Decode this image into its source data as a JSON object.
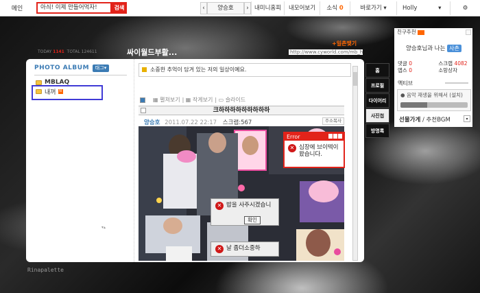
{
  "topbar": {
    "home": "메인",
    "search_value": "아싀! 이제 만들어먹자!",
    "search_button": "검색",
    "user_name": "양승호",
    "nav": [
      "내미니홈피",
      "내모어보기",
      "소식",
      "바로가기"
    ],
    "news_count": "0",
    "account": "Holly"
  },
  "header": {
    "today_label": "TODAY",
    "today_value": "1141",
    "total_label": "TOTAL",
    "total_value": "124611",
    "title": "싸이월드부활...",
    "ilchon": "+일촌맺기",
    "url": "http://www.cyworld.com/mb_ho"
  },
  "album": {
    "title": "PHOTO ALBUM",
    "tag_button": "태그",
    "folders": [
      "MBLAQ",
      "내꺼"
    ]
  },
  "post": {
    "notice": "소중한 추억이 담겨 있는 저의 일상이예요.",
    "view_options": [
      "펼쳐보기",
      "작게보기",
      "슬라이드"
    ],
    "title": "크하하하하하하하하하",
    "author": "양승호",
    "date": "2011.07.22 22:17",
    "scrap": "스크랩:567",
    "addr_button": "주소복사"
  },
  "dialogs": {
    "error_title": "Error",
    "error_text": "심장에 브이텍이 왔습니다.",
    "dialog2_text": "밥을 사주시겠습니",
    "ok": "확인",
    "dialog3_text": "날 좀더소중하"
  },
  "side_tabs": [
    "홈",
    "프로필",
    "다이어리",
    "사진첩",
    "방명록"
  ],
  "right": {
    "friend_rec": "친구추천",
    "friend_text": "양승호님과 나는",
    "relation": "사촌",
    "stats": {
      "comments_label": "댓글",
      "comments": "0",
      "scrap_label": "스크랩",
      "scrap": "4082",
      "apps_label": "앱스",
      "apps": "0",
      "gift_label": "소망상자"
    },
    "active": "액티브",
    "bgm_text": "음악 재생을 위해서 (설치)",
    "gift": "선물가게",
    "bgm": "/ 추천BGM"
  },
  "footer": "Rinapalette",
  "colors": {
    "accent_red": "#e2231a",
    "album_blue": "#3b7bb4",
    "selection_box": "#3f3ad6"
  }
}
